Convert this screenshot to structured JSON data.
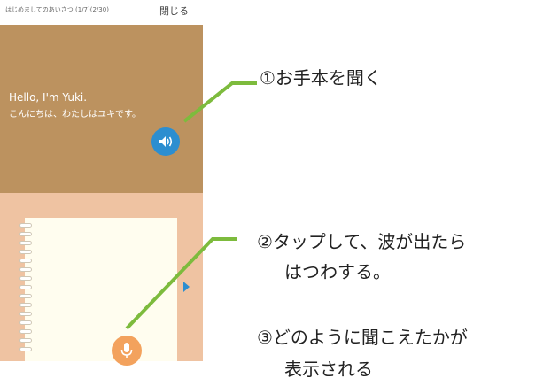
{
  "header": {
    "lesson_title": "はじめましてのあいさつ (1/7)(2/30)",
    "close_label": "閉じる"
  },
  "screen": {
    "greeting_en": "Hello, I'm Yuki.",
    "greeting_ja": "こんにちは、わたしはユキです。"
  },
  "annotations": {
    "step1": "①お手本を聞く",
    "step2_line1": "②タップして、波が出たら",
    "step2_line2": "はつわする。",
    "step3_line1": "③どのように聞こえたかが",
    "step3_line2": "表示される"
  },
  "colors": {
    "top_panel": "#bc925f",
    "bottom_panel": "#efc3a2",
    "speaker": "#2c8ed0",
    "mic": "#f3a25d",
    "callout": "#7dbb3d"
  }
}
